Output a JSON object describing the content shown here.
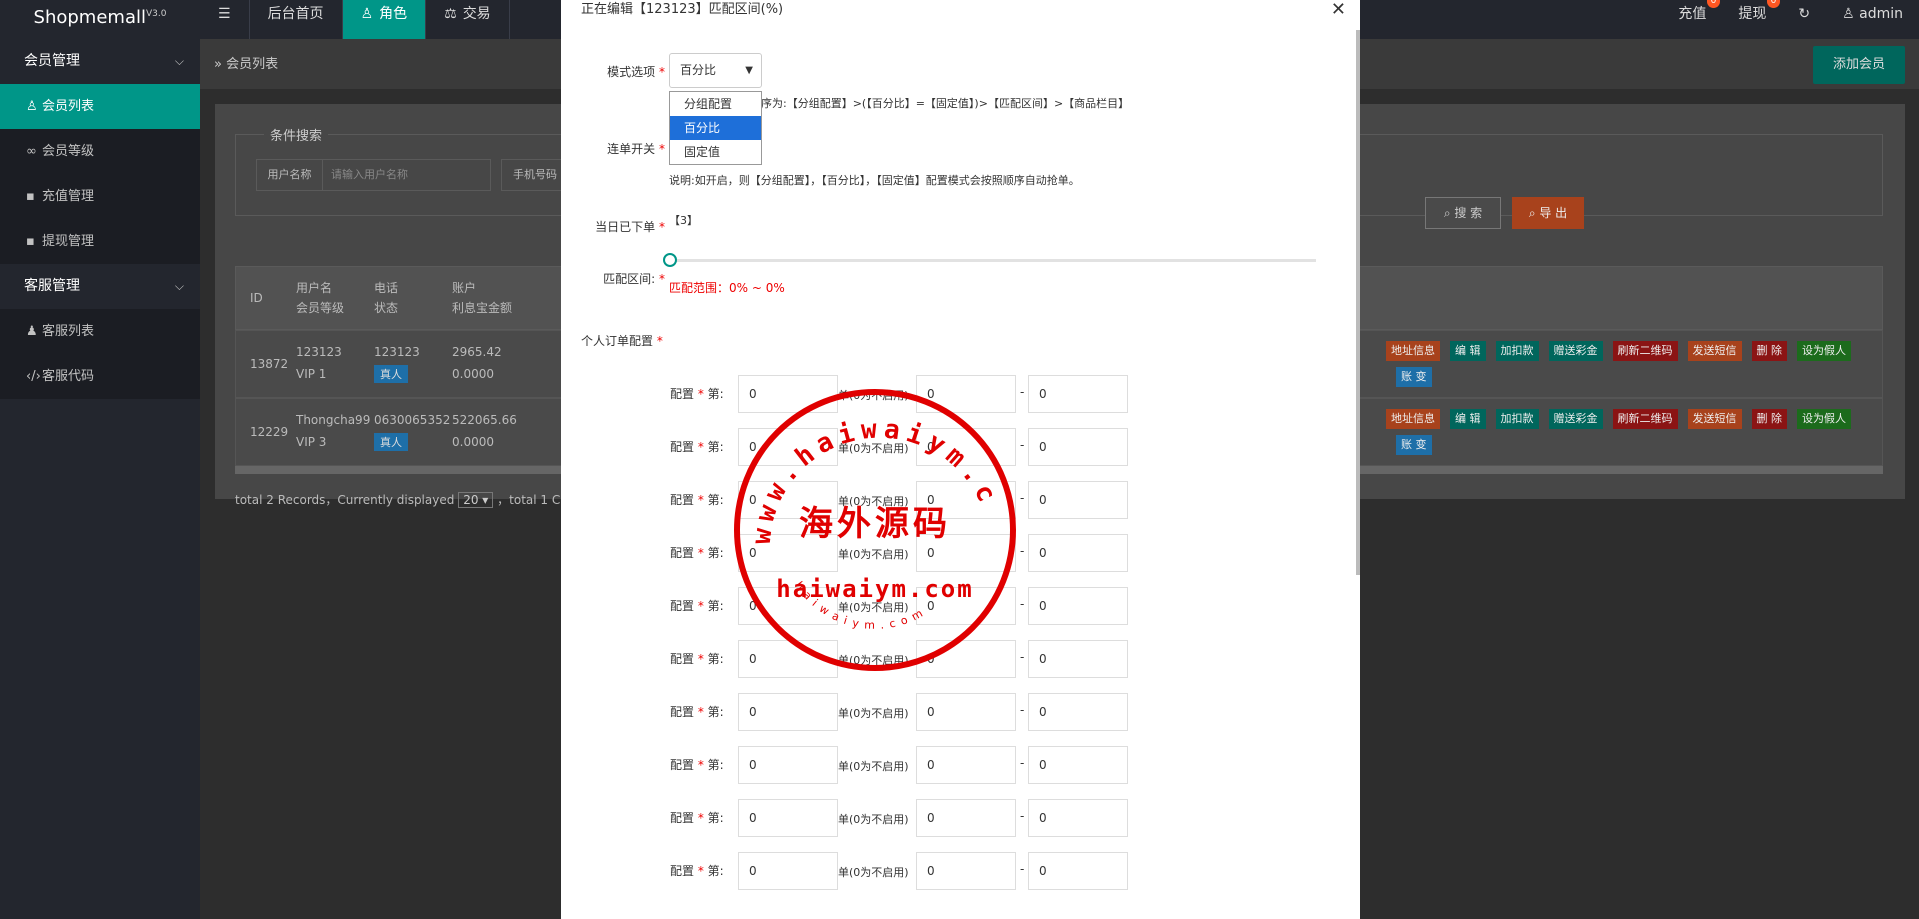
{
  "header": {
    "logo": "Shopmemall",
    "version": "V3.0",
    "nav": [
      {
        "icon": "menu-icon",
        "label": ""
      },
      {
        "icon": "",
        "label": "后台首页"
      },
      {
        "icon": "user-icon",
        "label": "角色"
      },
      {
        "icon": "scale-icon",
        "label": "交易"
      }
    ],
    "right": {
      "recharge_label": "充值",
      "recharge_badge": "0",
      "withdraw_label": "提现",
      "withdraw_badge": "0",
      "user_label": "admin"
    }
  },
  "sidebar": {
    "group1": "会员管理",
    "items1": [
      "会员列表",
      "会员等级",
      "充值管理",
      "提现管理"
    ],
    "group2": "客服管理",
    "items2": [
      "客服列表",
      "客服代码"
    ]
  },
  "main": {
    "breadcrumb": "会员列表",
    "add_button": "添加会员",
    "filter_legend": "条件搜索",
    "filter_user_label": "用户名称",
    "filter_user_placeholder": "请输入用户名称",
    "filter_phone_label": "手机号码",
    "search_button": "搜 索",
    "export_button": "导 出",
    "columns": {
      "id": "ID",
      "username": "用户名",
      "level": "会员等级",
      "phone": "电话",
      "status": "状态",
      "account": "账户",
      "interest": "利息宝金额"
    },
    "rows": [
      {
        "id": "13872",
        "username": "123123",
        "level": "VIP 1",
        "phone": "123123",
        "status": "真人",
        "account": "2965.42",
        "interest": "0.0000"
      },
      {
        "id": "12229",
        "username": "Thongcha99",
        "level": "VIP 3",
        "phone": "0630065352",
        "status": "真人",
        "account": "522065.66",
        "interest": "0.0000"
      }
    ],
    "ops": [
      "地址信息",
      "编 辑",
      "加扣款",
      "赠送彩金",
      "刷新二维码",
      "发送短信",
      "删 除",
      "设为假人"
    ],
    "ops_row2": "账 变",
    "paging_prefix": "total 2 Records，Currently displayed",
    "paging_size": "20",
    "paging_suffix": "，total 1 C"
  },
  "modal": {
    "title": "正在编辑【123123】匹配区间(%)",
    "close": "✕",
    "mode_label": "模式选项",
    "mode_selected": "百分比",
    "mode_options": [
      "分组配置",
      "百分比",
      "固定值"
    ],
    "mode_note": "序为:【分组配置】>(【百分比】=【固定值】)>【匹配区间】>【商品栏目】",
    "chain_label": "连单开关",
    "chain_note": "说明:如开启，则【分组配置】，【百分比】，【固定值】配置模式会按照顺序自动抢单。",
    "today_label": "当日已下单",
    "today_value": "【3】",
    "range_label": "匹配区间:",
    "range_value": 0,
    "range_text": "匹配范围：0% ~ 0%",
    "personal_label": "个人订单配置",
    "cfg_label": "配置",
    "cfg_nth": "第:",
    "cfg_unit": "单(0为不启用)",
    "cfg_dash": "-",
    "cfg_rows": [
      [
        "0",
        "0",
        "0"
      ],
      [
        "0",
        "0",
        "0"
      ],
      [
        "0",
        "0",
        "0"
      ],
      [
        "0",
        "0",
        "0"
      ],
      [
        "0",
        "0",
        "0"
      ],
      [
        "0",
        "0",
        "0"
      ],
      [
        "0",
        "0",
        "0"
      ],
      [
        "0",
        "0",
        "0"
      ],
      [
        "0",
        "0",
        "0"
      ],
      [
        "0",
        "0",
        "0"
      ]
    ]
  },
  "stamp": {
    "top_text": "www.haiwaiym.com",
    "center_text": "海外源码",
    "bottom_text": "haiwaiym.com",
    "small_text": "haiwaiym.com",
    "color": "#e00000"
  },
  "colors": {
    "accent": "#009688",
    "header_bg": "#23262e",
    "danger": "#ff5722"
  }
}
